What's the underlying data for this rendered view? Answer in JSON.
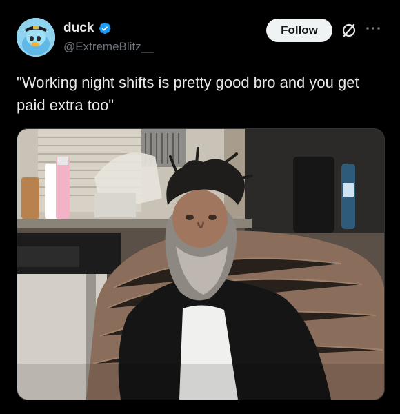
{
  "author": {
    "name": "duck",
    "handle": "@ExtremeBlitz__",
    "verified": true,
    "avatar_icon": "duck-avatar-icon"
  },
  "actions": {
    "follow_label": "Follow",
    "grok_icon": "grok-icon",
    "more_icon": "more-options-icon"
  },
  "tweet": {
    "text": "\"Working night shifts is pretty good bro and you get paid extra too\""
  },
  "colors": {
    "background": "#000000",
    "text_primary": "#e7e9ea",
    "text_secondary": "#71767b",
    "verified_blue": "#1d9bf0",
    "follow_bg": "#eff3f4"
  }
}
